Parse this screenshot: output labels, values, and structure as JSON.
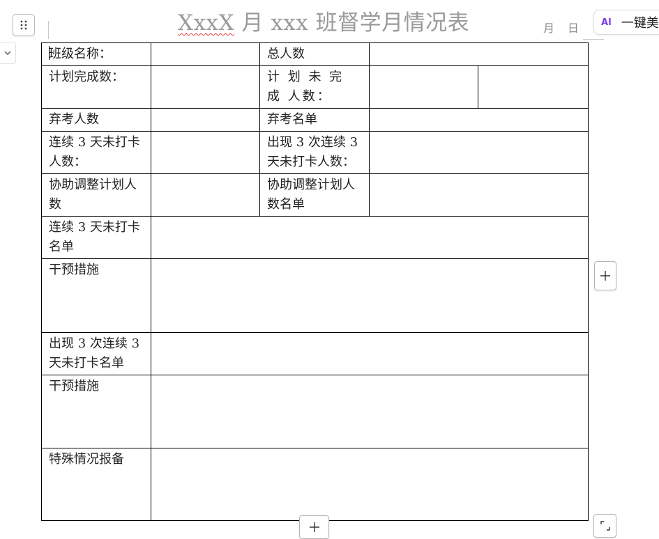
{
  "document": {
    "title_prefix": "XxxX",
    "title_rest": " 月 xxx 班督学月情况表",
    "month_label": "月",
    "day_label": "日"
  },
  "toolbar": {
    "ai_badge": "AI",
    "ai_label": "一键美化"
  },
  "icons": {
    "drag_handle": "grid-dots-icon",
    "collapse": "chevron-down-icon",
    "add_row": "plus-icon",
    "add_column": "plus-icon",
    "resize": "resize-corner-icon"
  },
  "table": {
    "class_name_label": "班级名称：",
    "total_people_label": "总人数",
    "plan_completed_label": "计划完成数：",
    "plan_uncompleted_label": "计 划 未 完 成 人数：",
    "abandon_count_label": "弃考人数",
    "abandon_list_label": "弃考名单",
    "no_checkin_3days_count_label": "连续 3 天未打卡人数：",
    "three_times_no_checkin_count_label": "出现 3 次连续 3 天未打卡人数：",
    "adjust_plan_count_label": "协助调整计划人数",
    "adjust_plan_list_label": "协助调整计划人数名单",
    "no_checkin_3days_list_label": "连续 3 天未打卡名单",
    "intervention_label_1": "干预措施",
    "three_times_no_checkin_list_label": "出现 3 次连续 3 天未打卡名单",
    "intervention_label_2": "干预措施",
    "special_report_label": "特殊情况报备"
  },
  "colors": {
    "title": "#9a9a9a",
    "ai_accent": "#7b3fe4",
    "spellcheck": "#e23b3b",
    "border": "#000000"
  }
}
